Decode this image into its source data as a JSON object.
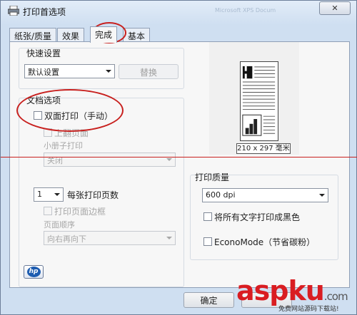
{
  "window": {
    "title": "打印首选项",
    "bg_title_text": "Microsoft XPS Docum",
    "close_glyph": "✕"
  },
  "tabs": [
    {
      "label": "纸张/质量",
      "active": false
    },
    {
      "label": "效果",
      "active": false
    },
    {
      "label": "完成",
      "active": true
    },
    {
      "label": "基本",
      "active": false
    }
  ],
  "quick_settings": {
    "title": "快速设置",
    "select_value": "默认设置",
    "replace_button": "替换"
  },
  "doc_options": {
    "title": "文档选项",
    "duplex_manual": "双面打印（手动）",
    "flip_pages_up": "上翻页面",
    "booklet_label": "小册子打印",
    "booklet_value": "关闭"
  },
  "pages_per_sheet": {
    "value": "1",
    "label": "每张打印页数",
    "print_borders": "打印页面边框",
    "page_order_label": "页面顺序",
    "page_order_value": "向右再向下"
  },
  "preview": {
    "size_label": "210 x 297 毫米"
  },
  "print_quality": {
    "title": "打印质量",
    "dpi_value": "600 dpi",
    "all_text_black": "将所有文字打印成黑色",
    "economode": "EconoMode（节省碳粉）"
  },
  "logo": {
    "text": "hp"
  },
  "footer": {
    "ok_button": "确定",
    "other_button": ""
  },
  "watermark": {
    "text_asp": "asp",
    "text_ku": "ku",
    "text_com": ".com",
    "caption": "免费网站源码下载站!"
  },
  "colors": {
    "annotation_red": "#c8201e",
    "accent_blue": "#1d5cb0"
  }
}
